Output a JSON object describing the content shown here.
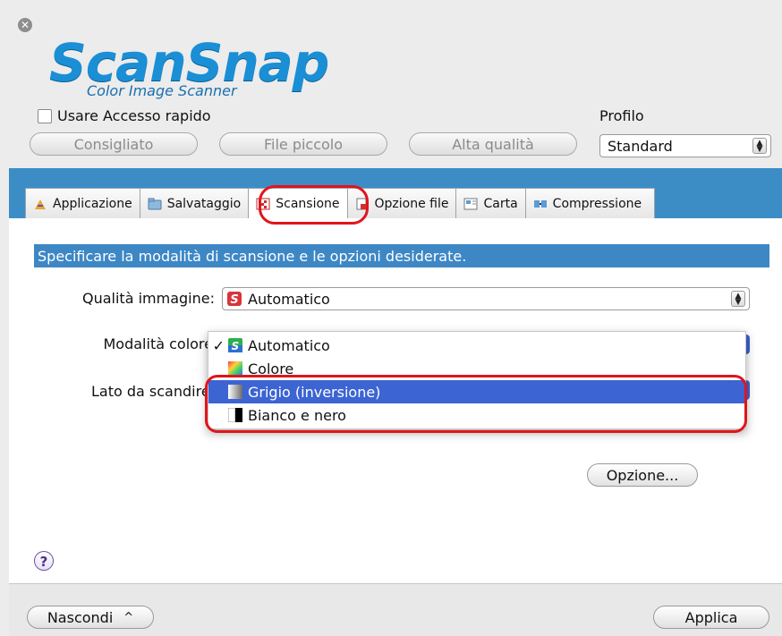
{
  "window": {
    "close_symbol": "✕"
  },
  "logo": {
    "main": "ScanSnap",
    "sub": "Color Image Scanner"
  },
  "quick_access": {
    "label": "Usare Accesso rapido",
    "checked": false
  },
  "profile": {
    "label": "Profilo",
    "value": "Standard"
  },
  "presets": {
    "recommended": "Consigliato",
    "small_file": "File piccolo",
    "high_quality": "Alta qualità"
  },
  "tabs": [
    {
      "label": "Applicazione",
      "icon": "application-icon"
    },
    {
      "label": "Salvataggio",
      "icon": "folder-icon"
    },
    {
      "label": "Scansione",
      "icon": "scan-icon",
      "active": true
    },
    {
      "label": "Opzione file",
      "icon": "file-option-icon"
    },
    {
      "label": "Carta",
      "icon": "paper-icon"
    },
    {
      "label": "Compressione",
      "icon": "compression-icon"
    }
  ],
  "panel": {
    "description": "Specificare la modalità di scansione e le opzioni desiderate.",
    "image_quality": {
      "label": "Qualità immagine:",
      "value": "Automatico"
    },
    "color_mode": {
      "label": "Modalità colore",
      "check": "✓"
    },
    "scan_side": {
      "label": "Lato da scandire"
    },
    "color_menu": [
      {
        "label": "Automatico",
        "checked": true
      },
      {
        "label": "Colore"
      },
      {
        "label": "Grigio (inversione)",
        "highlighted": true
      },
      {
        "label": "Bianco e nero"
      }
    ],
    "option_button": "Opzione..."
  },
  "help": "?",
  "footer": {
    "hide_button": "Nascondi",
    "hide_arrow": "^",
    "apply_button": "Applica"
  },
  "colors": {
    "accent": "#3c8dc6",
    "selection": "#3c64d2",
    "highlight_ring": "#e1141b",
    "logo": "#1a8fd6"
  }
}
